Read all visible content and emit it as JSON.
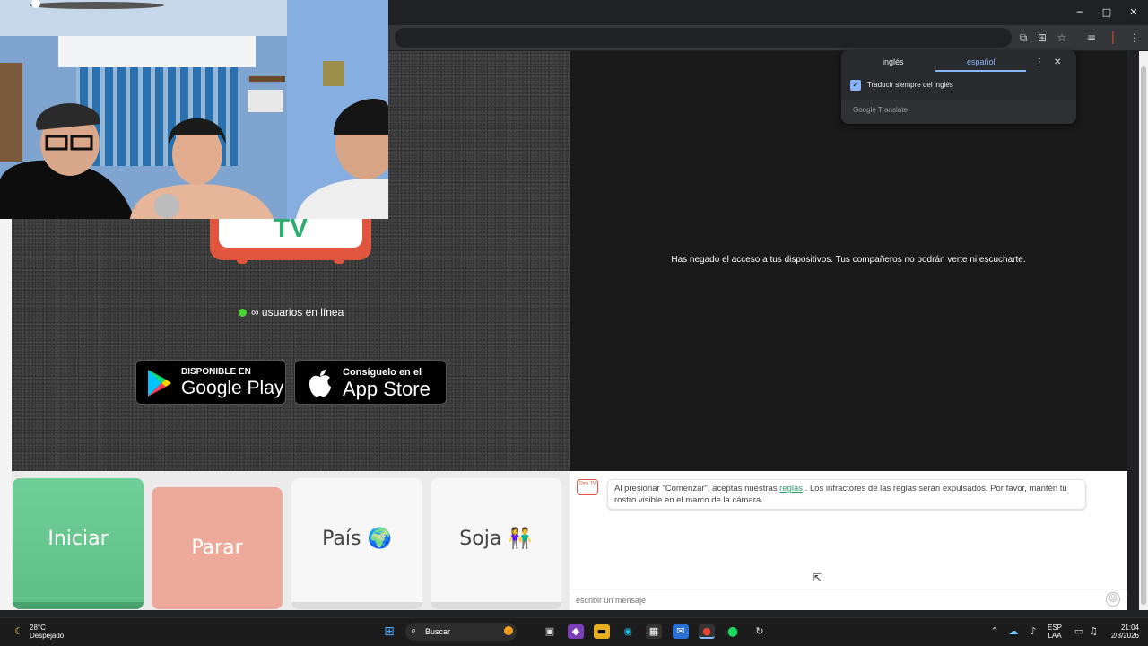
{
  "browser": {
    "window_controls": {
      "minimize": "─",
      "maximize": "□",
      "close": "✕"
    },
    "toolbar_icons": [
      "translate-icon",
      "install-icon",
      "bookmark-star-icon",
      "tab-search-icon",
      "profile-icon",
      "menu-icon"
    ]
  },
  "translate_popup": {
    "tab_source": "inglés",
    "tab_target": "español",
    "always_translate_label": "Traducir siempre del inglés",
    "always_translate_checked": true,
    "brand": "Google Translate"
  },
  "left_panel": {
    "logo_text": "TV",
    "online_text": "∞ usuarios en línea",
    "google_play": {
      "small": "DISPONIBLE EN",
      "big": "Google Play"
    },
    "app_store": {
      "small": "Consíguelo en el",
      "big": "App Store"
    }
  },
  "right_panel": {
    "notice": "Has negado el acceso a tus dispositivos. Tus compañeros no podrán verte ni escucharte."
  },
  "controls": {
    "start_label": "Iniciar",
    "stop_label": "Parar",
    "country_label": "País 🌍",
    "gender_label": "Soja 👫"
  },
  "chat": {
    "icon_text": "Ome TV",
    "message_prefix": "Al presionar \"Comenzar\", aceptas nuestras",
    "message_link": "reglas",
    "message_suffix": ". Los infractores de las reglas serán expulsados. Por favor, mantén tu rostro visible en el marco de la cámara.",
    "input_placeholder": "escribir un mensaje"
  },
  "colors": {
    "start": "#6fcf97",
    "stop": "#eda99a",
    "brand_red": "#e0553d",
    "brand_green": "#2eab6f",
    "online_dot": "#4cd137"
  },
  "taskbar": {
    "weather_temp": "28°C",
    "weather_desc": "Despejado",
    "search_label": "Buscar",
    "lang_top": "ESP",
    "lang_bottom": "LAA",
    "time": "21:04",
    "date": "2/3/2026"
  }
}
